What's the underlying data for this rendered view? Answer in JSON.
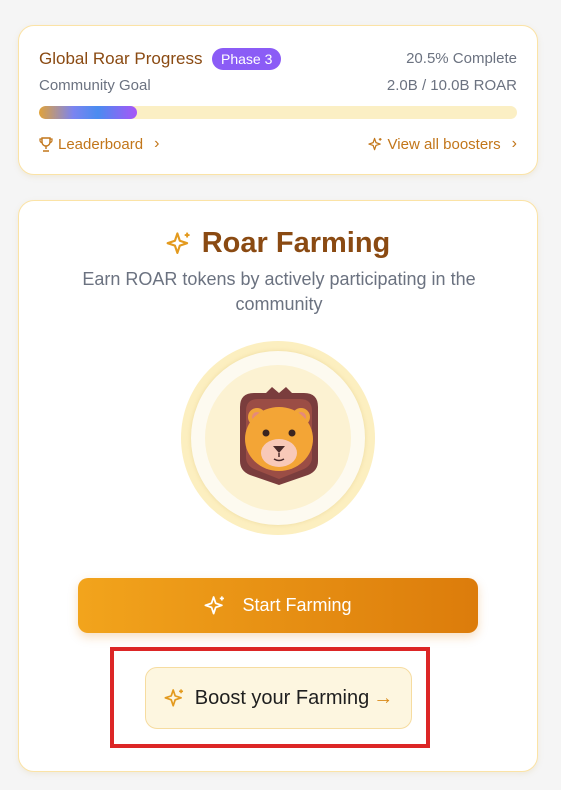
{
  "global_progress": {
    "title": "Global Roar Progress",
    "phase_badge": "Phase 3",
    "complete_text": "20.5% Complete",
    "progress_fraction": 0.205,
    "goal_label": "Community Goal",
    "goal_amount": "2.0B / 10.0B ROAR",
    "leaderboard_label": "Leaderboard",
    "boosters_label": "View all boosters",
    "icons": [
      "trophy-icon",
      "sparkle-icon",
      "chevron-right-icon"
    ]
  },
  "farming": {
    "title": "Roar Farming",
    "subtitle": "Earn ROAR tokens by actively participating in the community",
    "start_button_label": "Start Farming",
    "boost_button_label": "Boost your Farming",
    "icons": [
      "sparkle-icon",
      "lion-avatar",
      "arrow-right-icon"
    ]
  },
  "colors": {
    "brand_brown": "#8a4a12",
    "accent_orange": "#dc7c0b",
    "phase_purple": "#8b5cf6",
    "highlight_red": "#dc2626"
  }
}
